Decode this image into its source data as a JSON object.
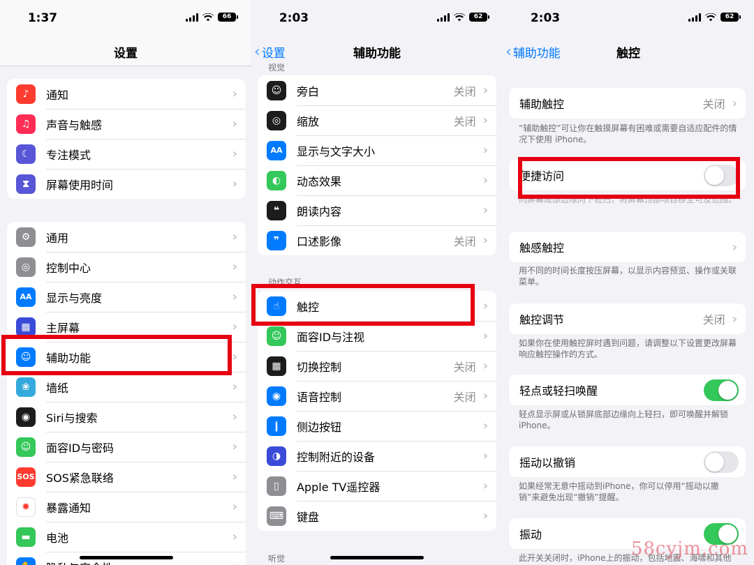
{
  "panel1": {
    "status": {
      "time": "1:37",
      "battery": "66"
    },
    "title": "设置",
    "group1": [
      {
        "label": "通知",
        "icon": "bell-icon",
        "color": "#ff3b30"
      },
      {
        "label": "声音与触感",
        "icon": "speaker-icon",
        "color": "#ff2d55"
      },
      {
        "label": "专注模式",
        "icon": "moon-icon",
        "color": "#5856d6"
      },
      {
        "label": "屏幕使用时间",
        "icon": "hourglass-icon",
        "color": "#5856d6"
      }
    ],
    "group2": [
      {
        "label": "通用",
        "icon": "gear-icon",
        "color": "#8e8e93"
      },
      {
        "label": "控制中心",
        "icon": "toggles-icon",
        "color": "#8e8e93"
      },
      {
        "label": "显示与亮度",
        "icon": "text-size-icon",
        "color": "#007aff"
      },
      {
        "label": "主屏幕",
        "icon": "home-grid-icon",
        "color": "#3a4bd8"
      },
      {
        "label": "辅助功能",
        "icon": "accessibility-icon",
        "color": "#007aff"
      },
      {
        "label": "墙纸",
        "icon": "flower-icon",
        "color": "#34aadc"
      },
      {
        "label": "Siri与搜索",
        "icon": "siri-icon",
        "color": "#1c1c1e"
      },
      {
        "label": "面容ID与密码",
        "icon": "face-id-icon",
        "color": "#34c759"
      },
      {
        "label": "SOS紧急联络",
        "icon": "sos-icon",
        "color": "#ff3b30"
      },
      {
        "label": "暴露通知",
        "icon": "exposure-icon",
        "color": "#ffffff"
      },
      {
        "label": "电池",
        "icon": "battery-icon",
        "color": "#34c759"
      },
      {
        "label": "隐私与安全性",
        "icon": "hand-icon",
        "color": "#007aff"
      }
    ]
  },
  "panel2": {
    "status": {
      "time": "2:03",
      "battery": "62"
    },
    "back": "设置",
    "title": "辅助功能",
    "section_vision": "视觉",
    "group1": [
      {
        "label": "旁白",
        "value": "关闭",
        "icon": "voiceover-icon",
        "color": "#1c1c1e"
      },
      {
        "label": "缩放",
        "value": "关闭",
        "icon": "zoom-icon",
        "color": "#1c1c1e"
      },
      {
        "label": "显示与文字大小",
        "value": "",
        "icon": "text-size-icon",
        "color": "#007aff"
      },
      {
        "label": "动态效果",
        "value": "",
        "icon": "motion-icon",
        "color": "#34c759"
      },
      {
        "label": "朗读内容",
        "value": "",
        "icon": "speech-icon",
        "color": "#1c1c1e"
      },
      {
        "label": "口述影像",
        "value": "关闭",
        "icon": "audio-description-icon",
        "color": "#007aff"
      }
    ],
    "section_interaction": "动作交互",
    "group2": [
      {
        "label": "触控",
        "value": "",
        "icon": "touch-hand-icon",
        "color": "#007aff"
      },
      {
        "label": "面容ID与注视",
        "value": "",
        "icon": "face-id-icon",
        "color": "#34c759"
      },
      {
        "label": "切换控制",
        "value": "关闭",
        "icon": "switch-control-icon",
        "color": "#1c1c1e"
      },
      {
        "label": "语音控制",
        "value": "关闭",
        "icon": "voice-control-icon",
        "color": "#007aff"
      },
      {
        "label": "侧边按钮",
        "value": "",
        "icon": "side-button-icon",
        "color": "#007aff"
      },
      {
        "label": "控制附近的设备",
        "value": "",
        "icon": "nearby-devices-icon",
        "color": "#3a4bd8"
      },
      {
        "label": "Apple TV遥控器",
        "value": "",
        "icon": "remote-icon",
        "color": "#8e8e93"
      },
      {
        "label": "键盘",
        "value": "",
        "icon": "keyboard-icon",
        "color": "#8e8e93"
      }
    ],
    "section_hearing": "听觉"
  },
  "panel3": {
    "status": {
      "time": "2:03",
      "battery": "62"
    },
    "back": "辅助功能",
    "title": "触控",
    "assistive_touch": {
      "label": "辅助触控",
      "value": "关闭",
      "note": "“辅助触控”可让你在触摸屏幕有困难或需要自适应配件的情况下使用 iPhone。"
    },
    "reachability": {
      "label": "便捷访问",
      "note": "向屏幕底部边缘向下轻扫，将屏幕顶部项目移至可及范围。",
      "on": false
    },
    "haptic_touch": {
      "label": "触感触控",
      "note": "用不同的时间长度按压屏幕，以显示内容预览、操作或关联菜单。"
    },
    "touch_accommodations": {
      "label": "触控调节",
      "value": "关闭",
      "note": "如果你在使用触控屏时遇到问题，请调整以下设置更改屏幕响应触控操作的方式。"
    },
    "tap_to_wake": {
      "label": "轻点或轻扫唤醒",
      "note": "轻点显示屏或从锁屏底部边缘向上轻扫，即可唤醒并解锁iPhone。",
      "on": true
    },
    "shake_to_undo": {
      "label": "摇动以撤销",
      "note": "如果经常无意中摇动到iPhone，你可以停用“摇动以撤销”来避免出现“撤销”提醒。",
      "on": false
    },
    "vibration": {
      "label": "振动",
      "note": "此开关关闭时，iPhone上的振动，包括地震、海啸和其他紧急警",
      "on": true
    }
  },
  "watermark": "58cyjm.com",
  "highlight_color": "#e60012"
}
